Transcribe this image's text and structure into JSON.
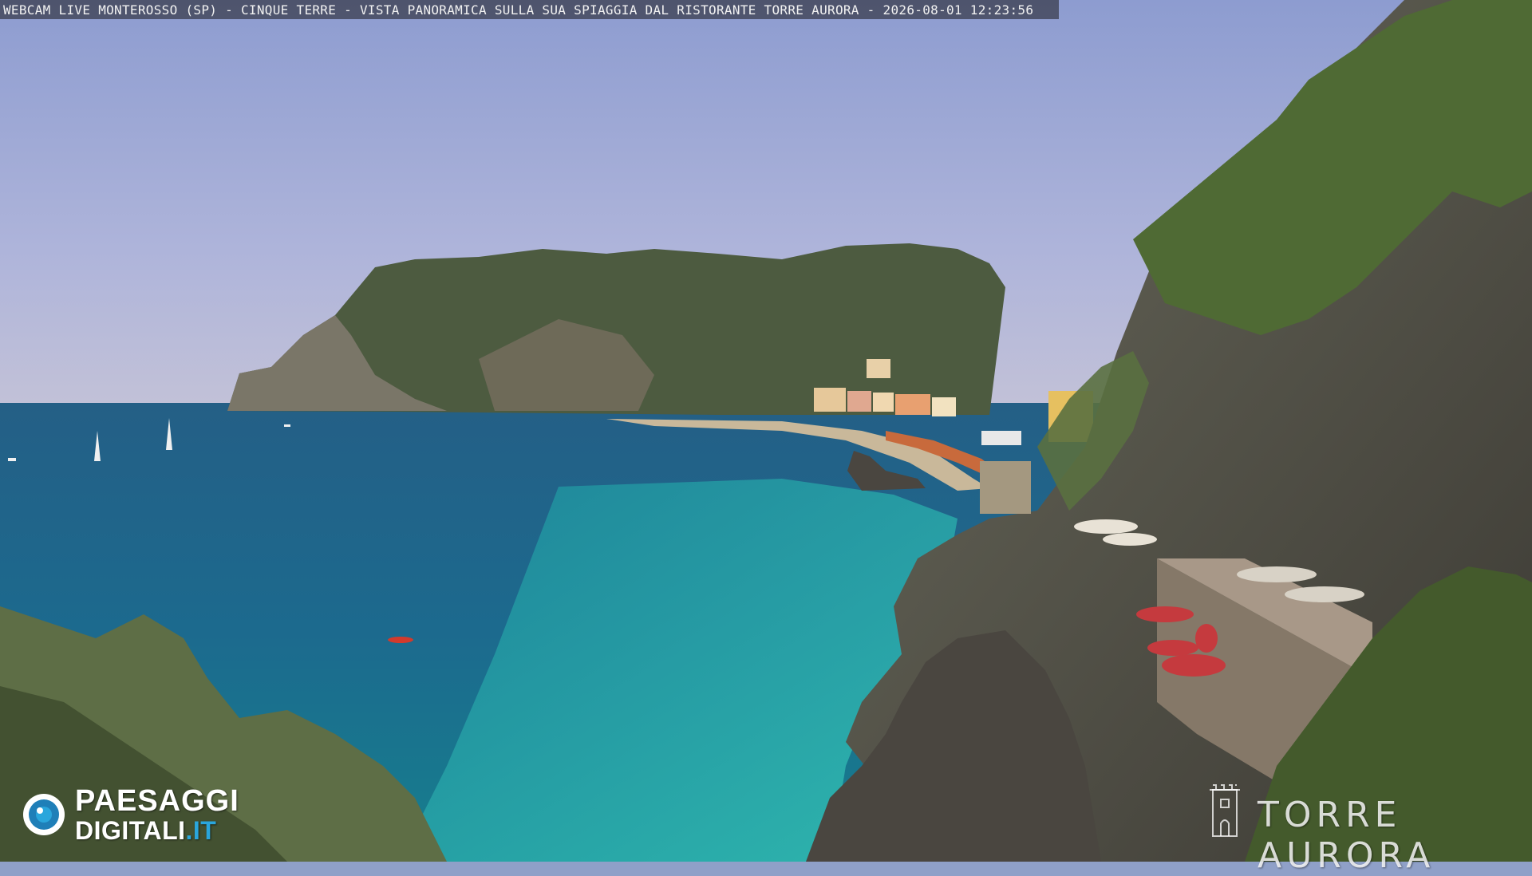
{
  "overlay": {
    "caption": "WEBCAM LIVE MONTEROSSO (SP) - CINQUE TERRE - VISTA PANORAMICA SULLA SUA SPIAGGIA DAL RISTORANTE TORRE AURORA - 2026-08-01 12:23:56"
  },
  "logo": {
    "line1": "PAESAGGI",
    "line2_main": "DIGITALI",
    "line2_accent": ".IT",
    "accent_color": "#2aa6dc"
  },
  "brand_watermark": {
    "text": "TORRE AURORA"
  },
  "scene": {
    "sky_color": "#a4acd6",
    "sea_color": "#1a6f90",
    "shallow_water_color": "#2bb0b0",
    "headland_color": "#4a5a3e"
  }
}
